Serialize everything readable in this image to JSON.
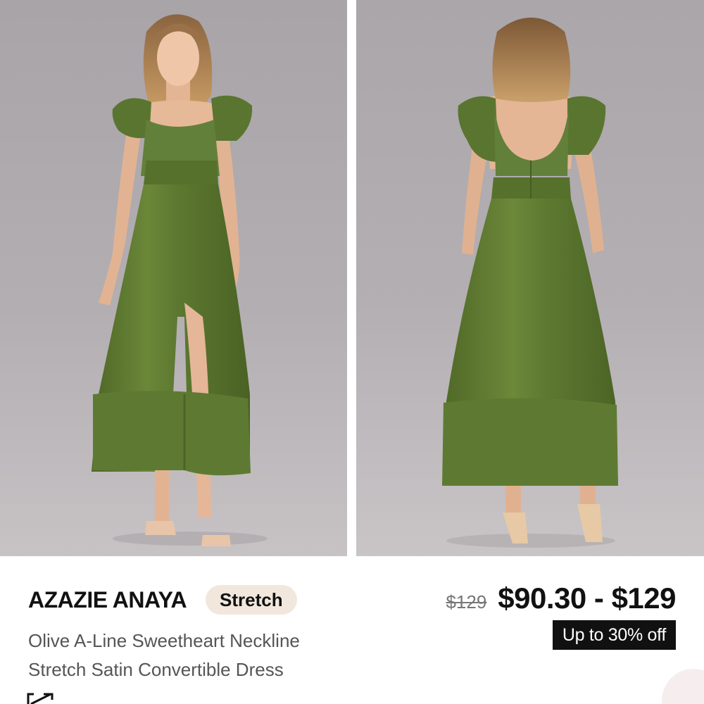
{
  "gallery": {
    "front_alt": "Olive A-Line Sweetheart Neckline Stretch Satin Convertible Dress front view",
    "back_alt": "Olive A-Line Sweetheart Neckline Stretch Satin Convertible Dress back view"
  },
  "product": {
    "brand": "AZAZIE ANAYA",
    "badge": "Stretch",
    "name_line1": "Olive A-Line Sweetheart Neckline",
    "name_line2": "Stretch Satin Convertible Dress",
    "original_price": "$129",
    "price_range": "$90.30 - $129",
    "discount": "Up to 30% off"
  },
  "colors": {
    "dress": "#5f7a30",
    "badge_bg": "#f1e7dc",
    "discount_bg": "#111111"
  },
  "icons": {
    "open_link": "external-link-icon"
  }
}
